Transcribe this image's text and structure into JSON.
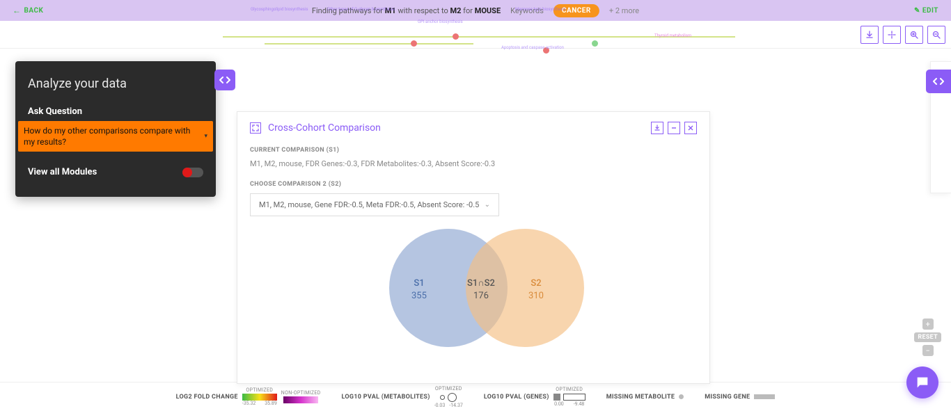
{
  "topbar": {
    "back": "BACK",
    "desc_prefix": "Finding pathways for ",
    "desc_m1": "M1",
    "desc_mid": " with respect to ",
    "desc_m2": "M2",
    "desc_for": " for ",
    "desc_species": "MOUSE",
    "keywords_label": "Keywords",
    "cancer_pill": "CANCER",
    "more": "+ 2 more",
    "edit": "EDIT"
  },
  "analyze": {
    "title": "Analyze your data",
    "ask_label": "Ask Question",
    "question": "How do my other comparisons compare with my results?",
    "view_modules": "View all Modules"
  },
  "cc": {
    "title": "Cross-Cohort Comparison",
    "current_label": "CURRENT COMPARISON (S1)",
    "current_text": "M1, M2, mouse, FDR Genes:-0.3, FDR Metabolites:-0.3, Absent Score:-0.3",
    "choose_label": "CHOOSE COMPARISON 2 (S2)",
    "select_text": "M1, M2, mouse, Gene FDR:-0.5, Meta FDR:-0.5, Absent Score: -0.5"
  },
  "venn": {
    "s1_name": "S1",
    "s1_count": "355",
    "inter_name": "S1∩S2",
    "inter_count": "176",
    "s2_name": "S2",
    "s2_count": "310"
  },
  "zoom": {
    "reset": "RESET"
  },
  "legend": {
    "fold_change": "LOG2 FOLD CHANGE",
    "optimized": "OPTIMIZED",
    "non_optimized": "NON-OPTIMIZED",
    "fc_min": "-35.32",
    "fc_max": "35.89",
    "pval_meta": "LOG10 PVAL (METABOLITES)",
    "pval_meta_min": "-0.03",
    "pval_meta_max": "-14.37",
    "pval_genes": "LOG10 PVAL (GENES)",
    "pval_genes_min": "0.00",
    "pval_genes_max": "-9.48",
    "missing_meta": "MISSING METABOLITE",
    "missing_gene": "MISSING GENE"
  },
  "chart_data": {
    "type": "venn",
    "sets": [
      {
        "name": "S1",
        "size": 355
      },
      {
        "name": "S2",
        "size": 310
      }
    ],
    "intersections": [
      {
        "sets": [
          "S1",
          "S2"
        ],
        "size": 176
      }
    ],
    "title": "Cross-Cohort Comparison"
  }
}
